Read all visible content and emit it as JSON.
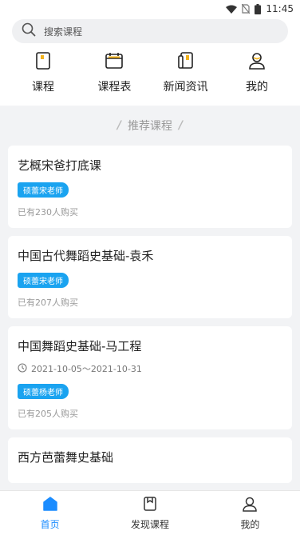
{
  "status": {
    "time": "11:45"
  },
  "search": {
    "placeholder": "搜索课程"
  },
  "quick_links": [
    {
      "label": "课程",
      "icon": "course-icon"
    },
    {
      "label": "课程表",
      "icon": "calendar-icon"
    },
    {
      "label": "新闻资讯",
      "icon": "news-icon"
    },
    {
      "label": "我的",
      "icon": "user-icon"
    }
  ],
  "section": {
    "title": "推荐课程"
  },
  "courses": [
    {
      "title": "艺概宋爸打底课",
      "teacher": "硕蕾宋老师",
      "buyers": "已有230人购买"
    },
    {
      "title": "中国古代舞蹈史基础-袁禾",
      "teacher": "硕蕾宋老师",
      "buyers": "已有207人购买"
    },
    {
      "title": "中国舞蹈史基础-马工程",
      "date": "2021-10-05～2021-10-31",
      "teacher": "硕蕾杨老师",
      "buyers": "已有205人购买"
    },
    {
      "title": "西方芭蕾舞史基础"
    }
  ],
  "tabbar": [
    {
      "label": "首页",
      "icon": "home-icon",
      "active": true
    },
    {
      "label": "发现课程",
      "icon": "discover-icon"
    },
    {
      "label": "我的",
      "icon": "profile-icon"
    }
  ],
  "colors": {
    "accent": "#1a8cff",
    "tag": "#1aa3f0"
  }
}
